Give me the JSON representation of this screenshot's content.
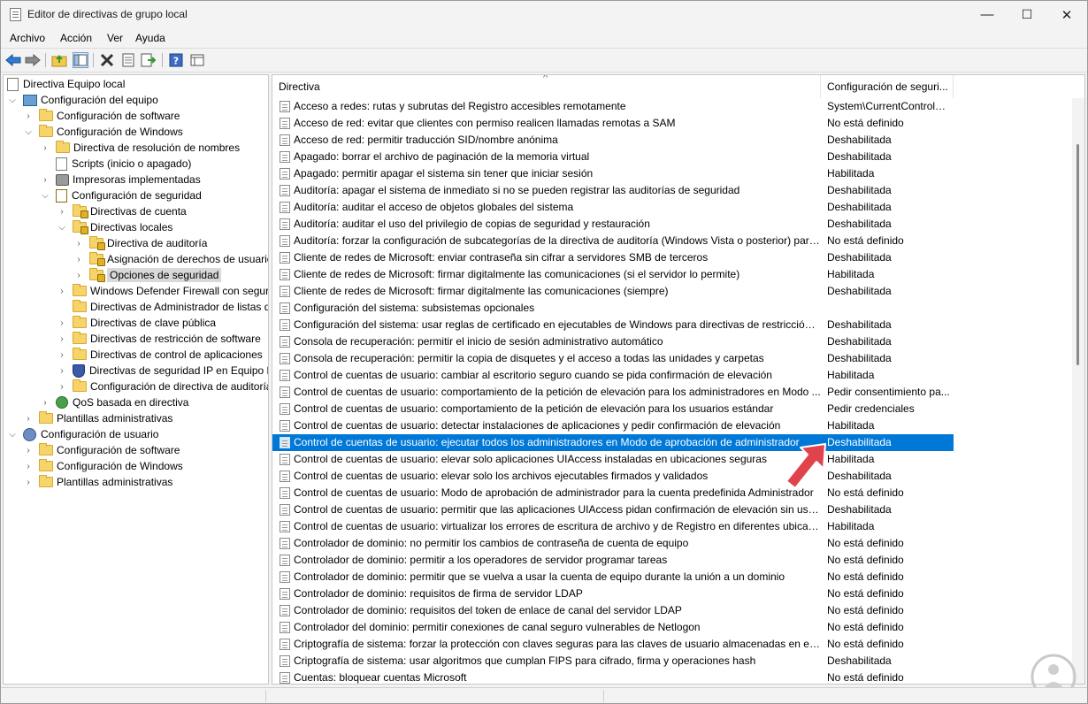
{
  "window": {
    "title": "Editor de directivas de grupo local"
  },
  "window_controls": {
    "minimize": "—",
    "maximize": "☐",
    "close": "✕"
  },
  "menu": [
    "Archivo",
    "Acción",
    "Ver",
    "Ayuda"
  ],
  "toolbar_icons": [
    "back-icon",
    "forward-icon",
    "up-folder-icon",
    "show-hide-tree-icon",
    "delete-icon",
    "properties-icon",
    "export-list-icon",
    "help-icon",
    "view-icon"
  ],
  "tree": [
    {
      "label": "Directiva Equipo local",
      "icon": "doc-icon"
    },
    {
      "label": "Configuración del equipo",
      "icon": "computer-icon"
    },
    {
      "label": "Configuración de software",
      "icon": "folder-icon"
    },
    {
      "label": "Configuración de Windows",
      "icon": "folder-icon"
    },
    {
      "label": "Directiva de resolución de nombres",
      "icon": "folder-icon"
    },
    {
      "label": "Scripts (inicio o apagado)",
      "icon": "doc-icon"
    },
    {
      "label": "Impresoras implementadas",
      "icon": "printer-icon"
    },
    {
      "label": "Configuración de seguridad",
      "icon": "security-icon"
    },
    {
      "label": "Directivas de cuenta",
      "icon": "lock-folder-icon"
    },
    {
      "label": "Directivas locales",
      "icon": "lock-folder-icon"
    },
    {
      "label": "Directiva de auditoría",
      "icon": "lock-folder-icon"
    },
    {
      "label": "Asignación de derechos de usuario",
      "icon": "lock-folder-icon"
    },
    {
      "label": "Opciones de seguridad",
      "icon": "lock-folder-icon"
    },
    {
      "label": "Windows Defender Firewall con seguridad avanzada",
      "icon": "folder-icon"
    },
    {
      "label": "Directivas de Administrador de listas de redes",
      "icon": "folder-icon"
    },
    {
      "label": "Directivas de clave pública",
      "icon": "folder-icon"
    },
    {
      "label": "Directivas de restricción de software",
      "icon": "folder-icon"
    },
    {
      "label": "Directivas de control de aplicaciones",
      "icon": "folder-icon"
    },
    {
      "label": "Directivas de seguridad IP en Equipo local",
      "icon": "shield-icon"
    },
    {
      "label": "Configuración de directiva de auditoría avanzada",
      "icon": "folder-icon"
    },
    {
      "label": "QoS basada en directiva",
      "icon": "qos-icon"
    },
    {
      "label": "Plantillas administrativas",
      "icon": "folder-icon"
    },
    {
      "label": "Configuración de usuario",
      "icon": "user-icon"
    },
    {
      "label": "Configuración de software",
      "icon": "folder-icon"
    },
    {
      "label": "Configuración de Windows",
      "icon": "folder-icon"
    },
    {
      "label": "Plantillas administrativas",
      "icon": "folder-icon"
    }
  ],
  "list": {
    "columns": [
      "Directiva",
      "Configuración de seguri..."
    ],
    "sort_indicator": "^",
    "rows": [
      [
        "Acceso a redes: rutas y subrutas del Registro accesibles remotamente",
        "System\\CurrentControlS..."
      ],
      [
        "Acceso de red: evitar que clientes con permiso realicen llamadas remotas a SAM",
        "No está definido"
      ],
      [
        "Acceso de red: permitir traducción SID/nombre anónima",
        "Deshabilitada"
      ],
      [
        "Apagado: borrar el archivo de paginación de la memoria virtual",
        "Deshabilitada"
      ],
      [
        "Apagado: permitir apagar el sistema sin tener que iniciar sesión",
        "Habilitada"
      ],
      [
        "Auditoría: apagar el sistema de inmediato si no se pueden registrar las auditorías de seguridad",
        "Deshabilitada"
      ],
      [
        "Auditoría: auditar el acceso de objetos globales del sistema",
        "Deshabilitada"
      ],
      [
        "Auditoría: auditar el uso del privilegio de copias de seguridad y restauración",
        "Deshabilitada"
      ],
      [
        "Auditoría: forzar la configuración de subcategorías de la directiva de auditoría (Windows Vista o posterior) para ...",
        "No está definido"
      ],
      [
        "Cliente de redes de Microsoft: enviar contraseña sin cifrar a servidores SMB de terceros",
        "Deshabilitada"
      ],
      [
        "Cliente de redes de Microsoft: firmar digitalmente las comunicaciones (si el servidor lo permite)",
        "Habilitada"
      ],
      [
        "Cliente de redes de Microsoft: firmar digitalmente las comunicaciones (siempre)",
        "Deshabilitada"
      ],
      [
        "Configuración del sistema: subsistemas opcionales",
        ""
      ],
      [
        "Configuración del sistema: usar reglas de certificado en ejecutables de Windows para directivas de restricción d...",
        "Deshabilitada"
      ],
      [
        "Consola de recuperación: permitir el inicio de sesión administrativo automático",
        "Deshabilitada"
      ],
      [
        "Consola de recuperación: permitir la copia de disquetes y el acceso a todas las unidades y carpetas",
        "Deshabilitada"
      ],
      [
        "Control de cuentas de usuario: cambiar al escritorio seguro cuando se pida confirmación de elevación",
        "Habilitada"
      ],
      [
        "Control de cuentas de usuario: comportamiento de la petición de elevación para los administradores en Modo ...",
        "Pedir consentimiento pa..."
      ],
      [
        "Control de cuentas de usuario: comportamiento de la petición de elevación para los usuarios estándar",
        "Pedir credenciales"
      ],
      [
        "Control de cuentas de usuario: detectar instalaciones de aplicaciones y pedir confirmación de elevación",
        "Habilitada"
      ],
      [
        "Control de cuentas de usuario: ejecutar todos los administradores en Modo de aprobación de administrador",
        "Deshabilitada"
      ],
      [
        "Control de cuentas de usuario: elevar solo aplicaciones UIAccess instaladas en ubicaciones seguras",
        "Habilitada"
      ],
      [
        "Control de cuentas de usuario: elevar solo los archivos ejecutables firmados y validados",
        "Deshabilitada"
      ],
      [
        "Control de cuentas de usuario: Modo de aprobación de administrador para la cuenta predefinida Administrador",
        "No está definido"
      ],
      [
        "Control de cuentas de usuario: permitir que las aplicaciones UIAccess pidan confirmación de elevación sin usar ...",
        "Deshabilitada"
      ],
      [
        "Control de cuentas de usuario: virtualizar los errores de escritura de archivo y de Registro en diferentes ubicacio...",
        "Habilitada"
      ],
      [
        "Controlador de dominio: no permitir los cambios de contraseña de cuenta de equipo",
        "No está definido"
      ],
      [
        "Controlador de dominio: permitir a los operadores de servidor programar tareas",
        "No está definido"
      ],
      [
        "Controlador de dominio: permitir que se vuelva a usar la cuenta de equipo durante la unión a un dominio",
        "No está definido"
      ],
      [
        "Controlador de dominio: requisitos de firma de servidor LDAP",
        "No está definido"
      ],
      [
        "Controlador de dominio: requisitos del token de enlace de canal del servidor LDAP",
        "No está definido"
      ],
      [
        "Controlador del dominio: permitir conexiones de canal seguro vulnerables de Netlogon",
        "No está definido"
      ],
      [
        "Criptografía de sistema: forzar la protección con claves seguras para las claves de usuario almacenadas en el eq...",
        "No está definido"
      ],
      [
        "Criptografía de sistema: usar algoritmos que cumplan FIPS para cifrado, firma y operaciones hash",
        "Deshabilitada"
      ],
      [
        "Cuentas: bloquear cuentas Microsoft",
        "No está definido"
      ]
    ]
  },
  "colors": {
    "selection": "#0078d7",
    "pointer_arrow": "#e0434b"
  }
}
